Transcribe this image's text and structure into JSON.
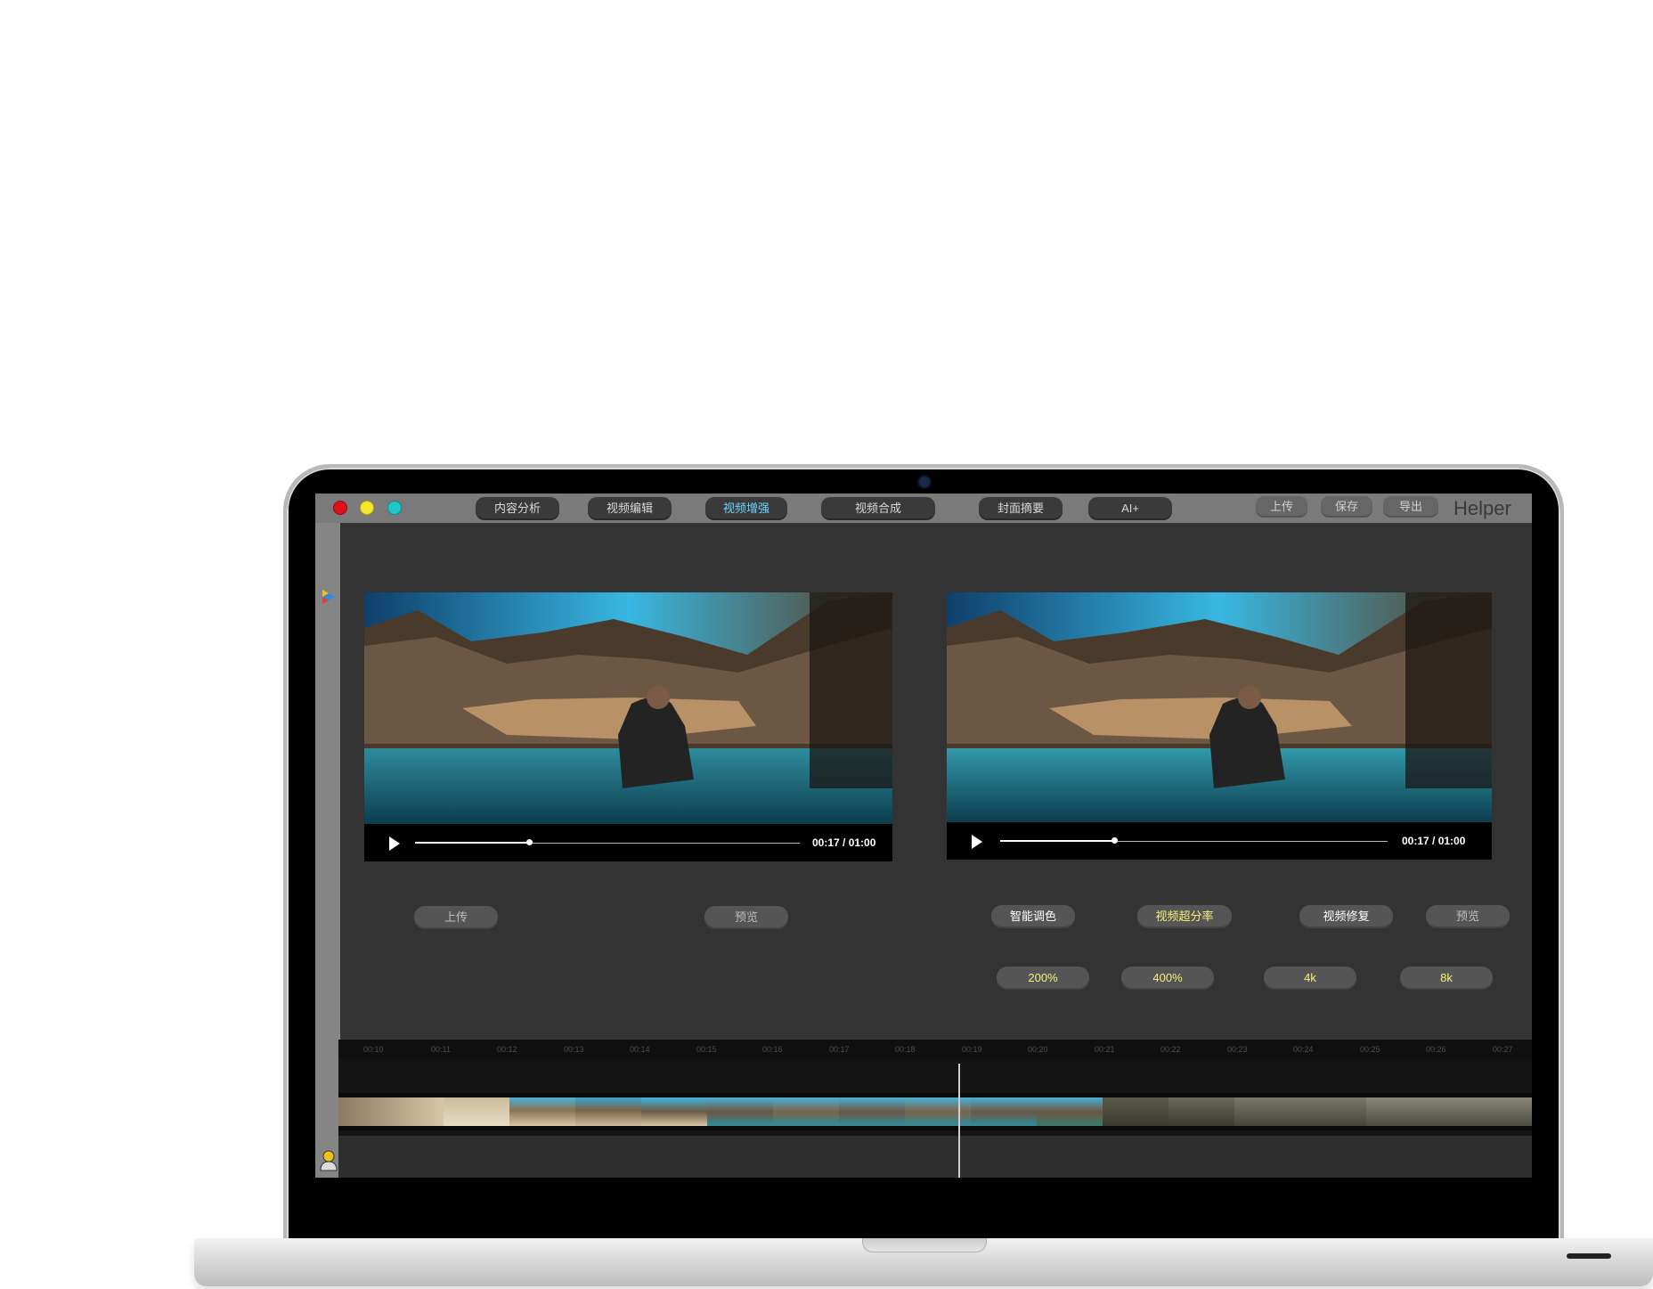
{
  "window": {
    "nav_tabs": [
      {
        "label": "内容分析",
        "active": false
      },
      {
        "label": "视频编辑",
        "active": false
      },
      {
        "label": "视频增强",
        "active": true
      },
      {
        "label": "视频合成",
        "active": false
      },
      {
        "label": "封面摘要",
        "active": false
      },
      {
        "label": "AI+",
        "active": false
      }
    ],
    "actions": {
      "upload": "上传",
      "save": "保存",
      "export": "导出"
    },
    "brand": "Helper",
    "colors": {
      "active_tab": "#6bd3ff",
      "highlight": "#f6f17a",
      "red": "#e0101a",
      "yellow": "#f5e62a",
      "teal": "#1fc7c7"
    }
  },
  "players": {
    "source": {
      "timecode": "00:17 / 01:00",
      "progress": 0.3
    },
    "enhanced": {
      "timecode": "00:17 / 01:00",
      "progress": 0.3
    }
  },
  "source_actions": {
    "upload": "上传",
    "preview": "预览"
  },
  "enhance_options": {
    "smart_color": "智能调色",
    "super_resolution": "视频超分率",
    "repair": "视频修复",
    "preview": "预览",
    "scales": [
      "200%",
      "400%",
      "4k",
      "8k"
    ]
  },
  "timeline": {
    "ticks": [
      "00:10",
      "00:11",
      "00:12",
      "00:13",
      "00:14",
      "00:15",
      "00:16",
      "00:17",
      "00:18",
      "00:19",
      "00:20",
      "00:21",
      "00:22",
      "00:23",
      "00:24",
      "00:25",
      "00:26",
      "00:27"
    ]
  },
  "icons": {
    "sidebar_top": "play-logo-icon",
    "sidebar_bottom": "user-icon",
    "play": "play-icon"
  }
}
